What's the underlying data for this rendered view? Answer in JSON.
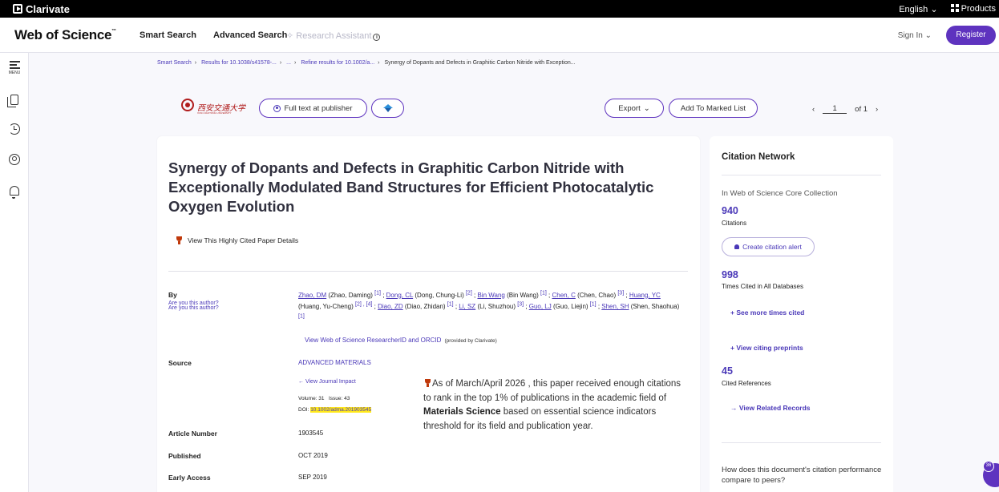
{
  "topbar": {
    "brand": "Clarivate",
    "language": "English",
    "products": "Products"
  },
  "header": {
    "logo": "Web of Science",
    "logo_tm": "™",
    "nav": {
      "smart_search": "Smart Search",
      "advanced_search": "Advanced Search",
      "research_assistant": "Research Assistant"
    },
    "sign_in": "Sign In",
    "register": "Register"
  },
  "rail": {
    "menu_label": "MENU"
  },
  "breadcrumb": {
    "items": [
      "Smart Search",
      "Results for 10.1038/s41578-...",
      "...",
      "Refine results for 10.1002/a...",
      "Synergy of Dopants and Defects in Graphitic Carbon Nitride with Exception..."
    ]
  },
  "actions": {
    "full_text": "Full text at publisher",
    "export": "Export",
    "add_marked": "Add To Marked List",
    "page_current": "1",
    "page_of": "of 1"
  },
  "record": {
    "title": "Synergy of Dopants and Defects in Graphitic Carbon Nitride with Exceptionally Modulated Band Structures for Efficient Photocatalytic Oxygen Evolution",
    "highly_cited_link": "View This Highly Cited Paper Details",
    "by_label": "By",
    "are_you_author": "Are you this author?",
    "authors": [
      {
        "short": "Zhao, DM",
        "full": "(Zhao, Daming)",
        "aff": "[1]",
        "sep": " ; "
      },
      {
        "short": "Dong, CL",
        "full": "(Dong, Chung-Li)",
        "aff": "[2]",
        "sep": " ; "
      },
      {
        "short": "Bin Wang",
        "full": "(Bin Wang)",
        "aff": "[1]",
        "sep": " ; "
      },
      {
        "short": "Chen, C",
        "full": "(Chen, Chao)",
        "aff": "[3]",
        "sep": " ; "
      },
      {
        "short": "Huang, YC",
        "full": "(Huang, Yu-Cheng)",
        "aff": "[2] , [4]",
        "sep": " ; "
      },
      {
        "short": "Diao, ZD",
        "full": "(Diao, Zhidan)",
        "aff": "[1]",
        "sep": " ; "
      },
      {
        "short": "Li, SZ",
        "full": "(Li, Shuzhou)",
        "aff": "[3]",
        "sep": " ; "
      },
      {
        "short": "Guo, LJ",
        "full": "(Guo, Liejin)",
        "aff": "[1]",
        "sep": " ; "
      },
      {
        "short": "Shen, SH",
        "full": "(Shen, Shaohua)",
        "aff": "[1]",
        "sep": ""
      }
    ],
    "researcher_id_link": "View Web of Science ResearcherID and ORCID",
    "researcher_id_note": "(provided by Clarivate)",
    "source_label": "Source",
    "source_value": "ADVANCED MATERIALS",
    "journal_impact_link": "View Journal Impact",
    "volume": "Volume: 31",
    "issue": "Issue: 43",
    "doi_label": "DOI:",
    "doi_value": "10.1002/adma.201903545",
    "article_number_label": "Article Number",
    "article_number_value": "1903545",
    "published_label": "Published",
    "published_value": "OCT 2019",
    "early_access_label": "Early Access",
    "early_access_value": "SEP 2019",
    "hc_note_prefix": "As of March/April 2026 , this paper received enough citations to rank in the top 1% of publications in the academic field of ",
    "hc_note_field": "Materials Science",
    "hc_note_suffix": " based on essential science indicators threshold for its field and publication year."
  },
  "citation_network": {
    "title": "Citation Network",
    "collection": "In Web of Science Core Collection",
    "citations_count": "940",
    "citations_label": "Citations",
    "create_alert": "Create citation alert",
    "times_cited_count": "998",
    "times_cited_label": "Times Cited in All Databases",
    "see_more": "+ See more times cited",
    "view_preprints": "+ View citing preprints",
    "cited_refs_count": "45",
    "cited_refs_label": "Cited References",
    "view_related": "→ View Related Records",
    "compare_question": "How does this document's citation performance compare to peers?"
  },
  "fab": {
    "badge": "36"
  },
  "colors": {
    "accent": "#5e33bf",
    "link": "#4a38b8",
    "trophy": "#c0390b",
    "highlight": "#ffe81a"
  }
}
